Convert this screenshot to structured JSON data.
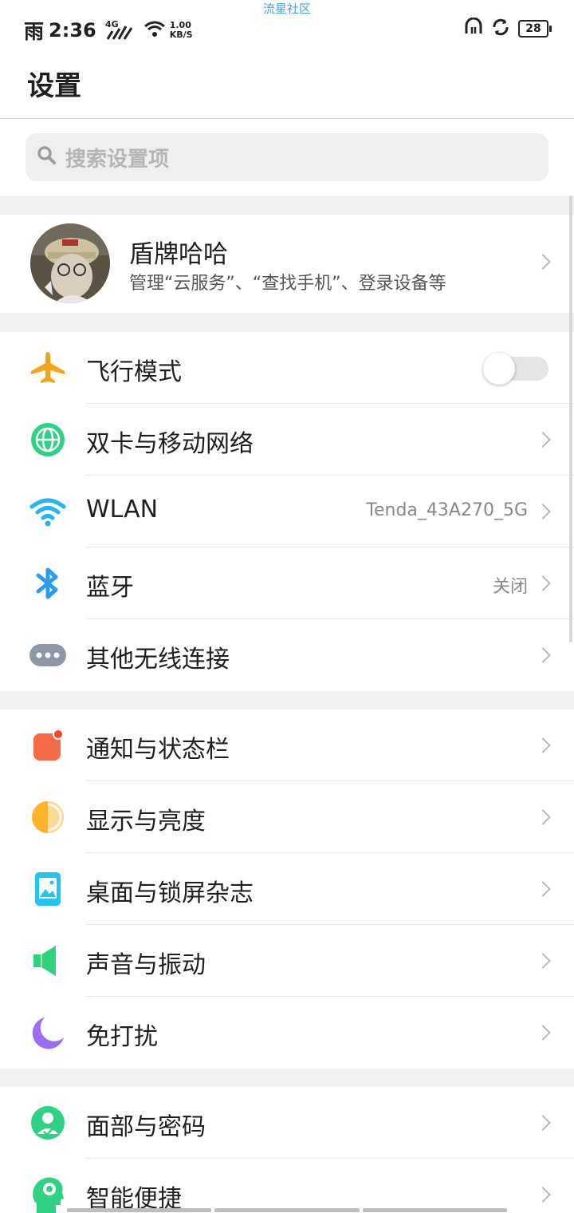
{
  "status": {
    "weather": "雨",
    "time": "2:36",
    "network": "4G",
    "speed_value": "1.00",
    "speed_unit": "KB/S",
    "watermark": "流星社区",
    "battery": "28",
    "icons": [
      "hd-icon",
      "sync-icon",
      "battery-icon"
    ]
  },
  "title": "设置",
  "search": {
    "placeholder": "搜索设置项"
  },
  "account": {
    "name": "盾牌哈哈",
    "subtitle": "管理“云服务”、“查找手机”、登录设备等"
  },
  "groups": [
    {
      "items": [
        {
          "label": "飞行模式",
          "icon": "airplane-icon",
          "toggle": "off",
          "color": "#f7a21b"
        },
        {
          "label": "双卡与移动网络",
          "icon": "globe-icon",
          "color": "#2fd184"
        },
        {
          "label": "WLAN",
          "icon": "wifi-icon",
          "value": "Tenda_43A270_5G",
          "color": "#27b4f0"
        },
        {
          "label": "蓝牙",
          "icon": "bluetooth-icon",
          "value": "关闭",
          "color": "#2c9cf1"
        },
        {
          "label": "其他无线连接",
          "icon": "more-connections-icon",
          "color": "#8e97a6"
        }
      ]
    },
    {
      "items": [
        {
          "label": "通知与状态栏",
          "icon": "notification-icon",
          "color": "#f46a47"
        },
        {
          "label": "显示与亮度",
          "icon": "brightness-icon",
          "color": "#ffb22c"
        },
        {
          "label": "桌面与锁屏杂志",
          "icon": "wallpaper-icon",
          "color": "#20c6f0"
        },
        {
          "label": "声音与振动",
          "icon": "sound-icon",
          "color": "#2fd27a"
        },
        {
          "label": "免打扰",
          "icon": "moon-icon",
          "color": "#9a6cf0"
        }
      ]
    },
    {
      "items": [
        {
          "label": "面部与密码",
          "icon": "face-password-icon",
          "color": "#2fd184"
        },
        {
          "label": "智能便捷",
          "icon": "smart-assist-icon",
          "color": "#2fd184"
        }
      ]
    }
  ]
}
